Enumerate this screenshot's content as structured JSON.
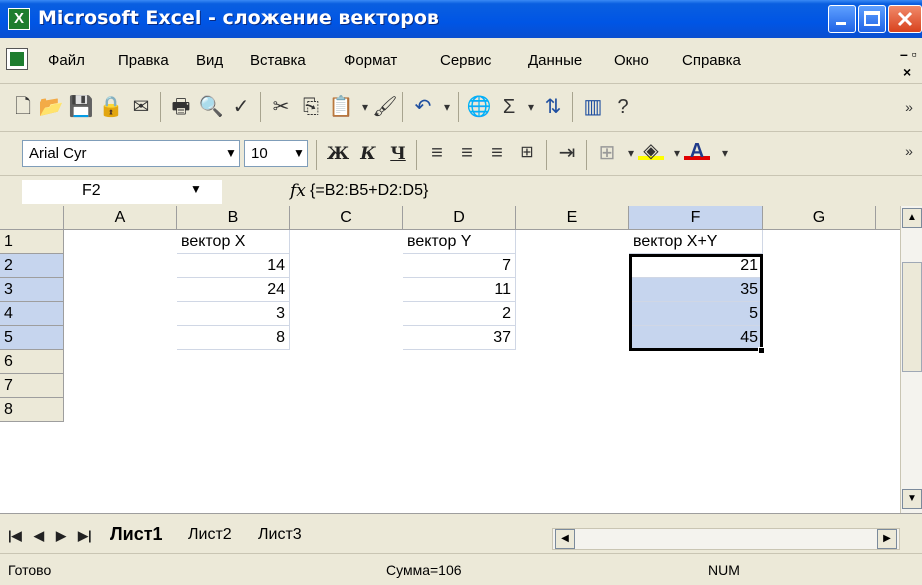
{
  "window": {
    "title": "Microsoft Excel - сложение векторов"
  },
  "menu": [
    "Файл",
    "Правка",
    "Вид",
    "Вставка",
    "Формат",
    "Сервис",
    "Данные",
    "Окно",
    "Справка"
  ],
  "format_toolbar": {
    "font": "Arial Cyr",
    "size": "10",
    "bold": "Ж",
    "italic": "К",
    "underline": "Ч"
  },
  "formula_bar": {
    "name_box": "F2",
    "formula": "{=B2:B5+D2:D5}"
  },
  "columns": [
    "A",
    "B",
    "C",
    "D",
    "E",
    "F",
    "G"
  ],
  "rows": [
    "1",
    "2",
    "3",
    "4",
    "5",
    "6",
    "7",
    "8"
  ],
  "cells": {
    "B1": "вектор X",
    "D1": "вектор Y",
    "F1": "вектор X+Y",
    "B2": "14",
    "D2": "7",
    "F2": "21",
    "B3": "24",
    "D3": "11",
    "F3": "35",
    "B4": "3",
    "D4": "2",
    "F4": "5",
    "B5": "8",
    "D5": "37",
    "F5": "45"
  },
  "sheets": [
    "Лист1",
    "Лист2",
    "Лист3"
  ],
  "status": {
    "ready": "Готово",
    "sum": "Сумма=106",
    "num": "NUM"
  }
}
